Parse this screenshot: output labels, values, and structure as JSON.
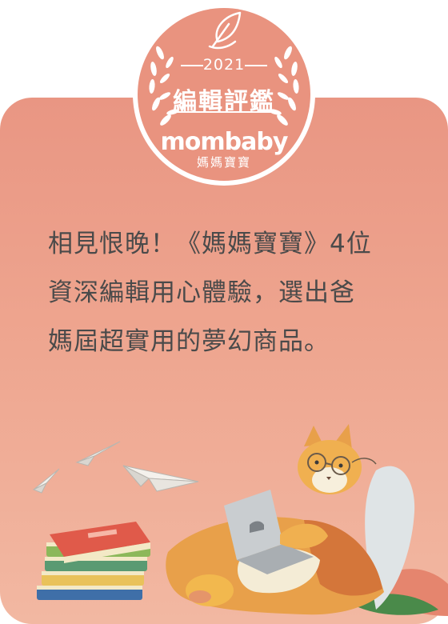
{
  "badge": {
    "year": "2021",
    "title": "編輯評鑑",
    "brand": "mombaby",
    "brand_sub": "媽媽寶寶"
  },
  "headline": {
    "lines": [
      "相見恨晚！《媽媽寶寶》4位",
      "資深編輯用心體驗，選出爸",
      "媽屆超實用的夢幻商品。"
    ]
  },
  "icons": {
    "badge_leaf": "feather-leaf-icon",
    "laurel": "laurel-wreath-icon",
    "illustration": "reading-cat-illustration"
  },
  "colors": {
    "card_top": "#e99683",
    "card_bottom": "#f2b8a2",
    "badge_fill": "#e9937f",
    "text": "#4a4a4a"
  }
}
